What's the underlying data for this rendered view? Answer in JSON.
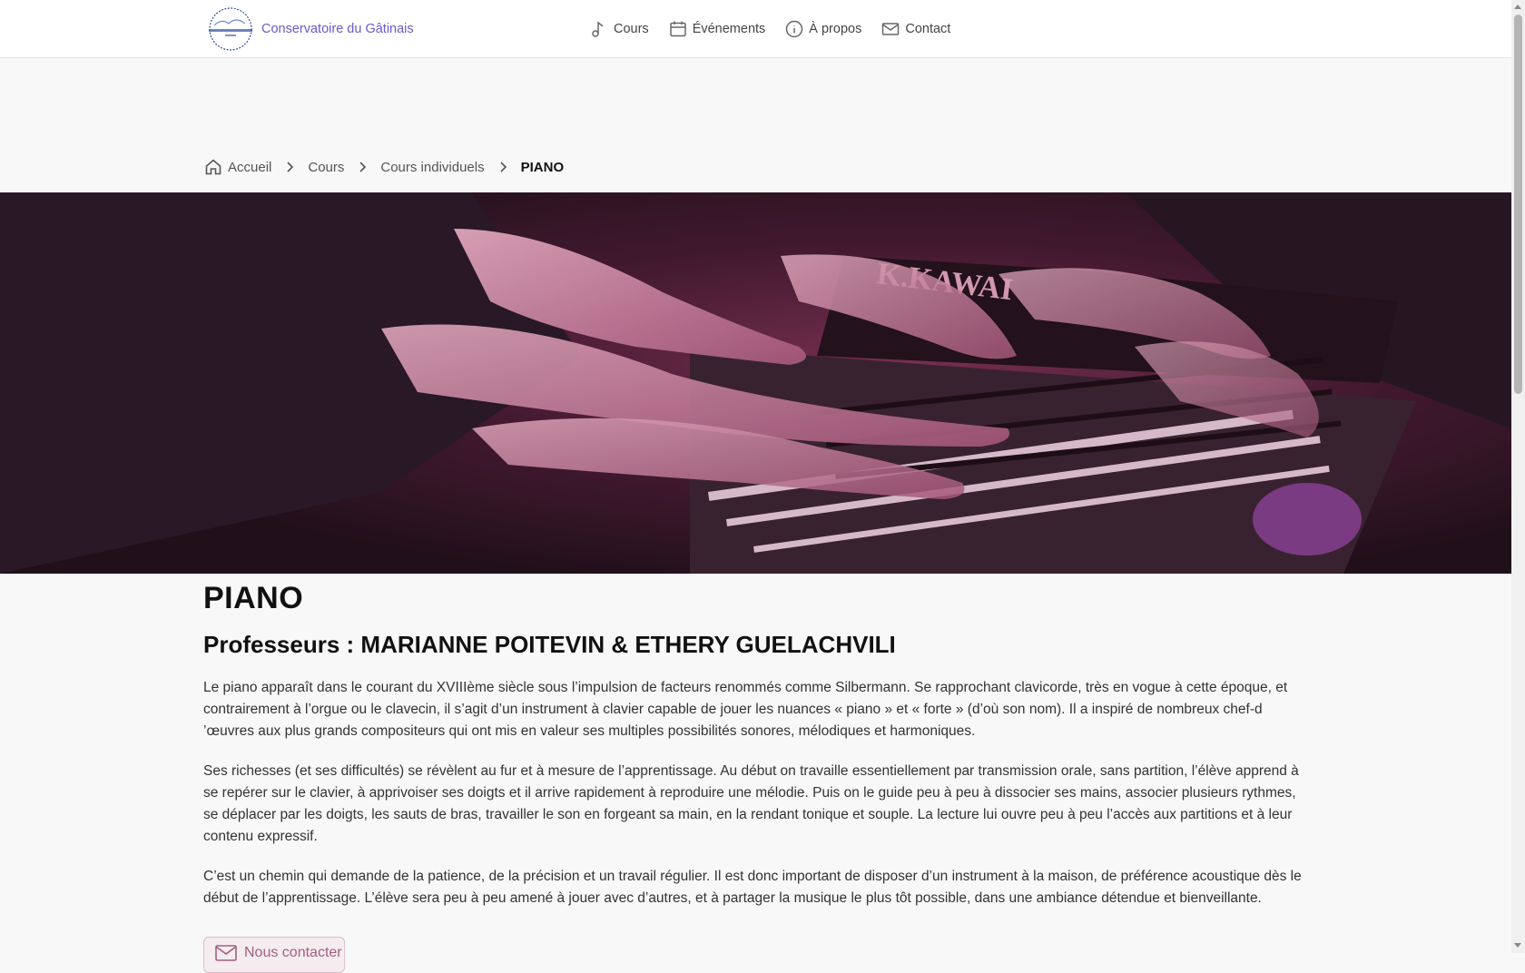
{
  "header": {
    "brand_name": "Conservatoire du Gâtinais",
    "nav": [
      {
        "label": "Cours",
        "icon": "music-note-icon"
      },
      {
        "label": "Événements",
        "icon": "calendar-icon"
      },
      {
        "label": "À propos",
        "icon": "info-icon"
      },
      {
        "label": "Contact",
        "icon": "mail-icon"
      }
    ]
  },
  "breadcrumb": {
    "home": "Accueil",
    "level1": "Cours",
    "level2": "Cours individuels",
    "current": "PIANO"
  },
  "hero": {
    "alt": "Mains sur un piano Kawai",
    "piano_brand": "K.KAWAI"
  },
  "content": {
    "title": "PIANO",
    "teachers": "Professeurs : MARIANNE POITEVIN & ETHERY GUELACHVILI",
    "paragraphs": [
      "Le piano apparaît dans le courant du XVIIIème siècle sous l’impulsion de facteurs renommés comme Silbermann. Se rapprochant clavicorde, très en vogue à cette époque, et contrairement à l’orgue ou le clavecin, il s’agit d’un instrument à clavier capable de jouer les nuances « piano » et « forte » (d’où son nom). Il a inspiré de nombreux chef-d ’œuvres aux plus grands compositeurs qui ont mis en valeur ses multiples possibilités sonores, mélodiques et harmoniques.",
      "Ses richesses (et ses difficultés) se révèlent au fur et à mesure de l’apprentissage. Au début on travaille essentiellement par transmission orale, sans partition, l’élève apprend à se repérer sur le clavier, à apprivoiser ses doigts et il arrive rapidement à reproduire une mélodie. Puis on le guide peu à peu à dissocier ses mains, associer plusieurs rythmes, se déplacer par les doigts, les sauts de bras, travailler le son en forgeant sa main, en la rendant tonique et souple. La lecture lui ouvre peu à peu l’accès aux partitions et à leur contenu expressif.",
      "C’est un chemin qui demande de la patience, de la précision et un travail régulier. Il est donc important de disposer d’un instrument à la maison, de préférence acoustique dès le début de l’apprentissage. L’élève sera peu à peu amené à jouer avec d’autres, et à partager la musique le plus tôt possible, dans une ambiance détendue et bienveillante."
    ],
    "contact_button": "Nous contacter"
  },
  "colors": {
    "brand": "#6a5acd",
    "button_text": "#a06080",
    "hero_tint": "#b04a7a"
  }
}
